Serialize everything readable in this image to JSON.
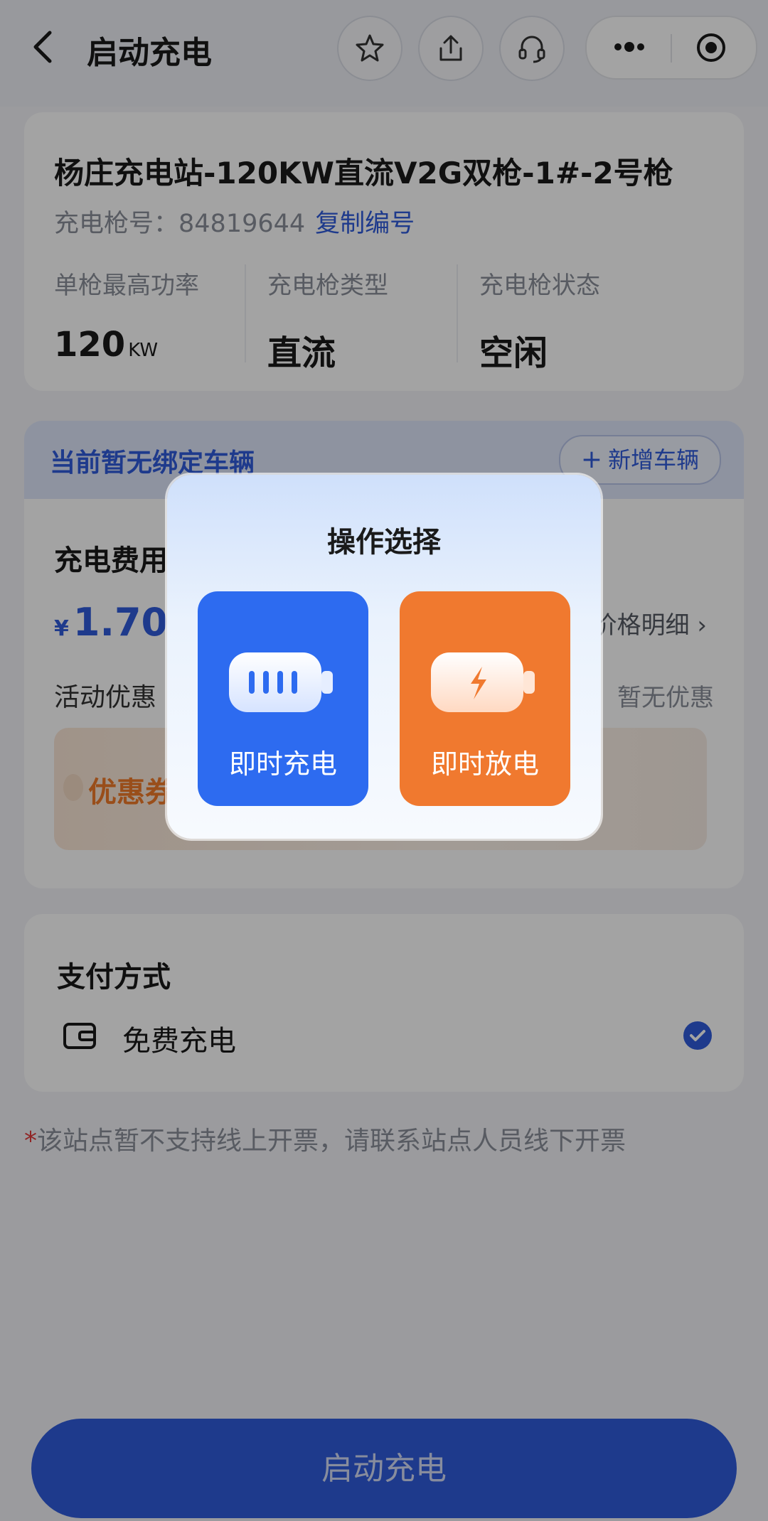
{
  "header": {
    "title": "启动充电",
    "icons": [
      "back-icon",
      "star-icon",
      "share-icon",
      "headset-icon",
      "more-icon",
      "target-icon"
    ]
  },
  "station": {
    "name": "杨庄充电站-120KW直流V2G双枪-1#-2号枪",
    "gun_label": "充电枪号：",
    "gun_number": "84819644",
    "copy_label": "复制编号",
    "specs": [
      {
        "label": "单枪最高功率",
        "value": "120",
        "unit": "KW"
      },
      {
        "label": "充电枪类型",
        "value": "直流",
        "unit": ""
      },
      {
        "label": "充电枪状态",
        "value": "空闲",
        "unit": ""
      }
    ]
  },
  "vehicle": {
    "status_text": "当前暂无绑定车辆",
    "add_label": "新增车辆"
  },
  "fee": {
    "title": "充电费用",
    "currency": "¥",
    "price": "1.70",
    "detail_label": "价格明细",
    "promo_label": "活动优惠",
    "promo_value": "暂无优惠",
    "coupon_label": "优惠券"
  },
  "payment": {
    "title": "支付方式",
    "option": "免费充电",
    "selected": true
  },
  "invoice_note": {
    "star": "*",
    "text": "该站点暂不支持线上开票，请联系站点人员线下开票"
  },
  "start_button": "启动充电",
  "modal": {
    "title": "操作选择",
    "options": [
      {
        "label": "即时充电",
        "color": "#2d6bf0",
        "icon": "battery-charge-icon"
      },
      {
        "label": "即时放电",
        "color": "#f0792f",
        "icon": "battery-discharge-icon"
      }
    ]
  },
  "colors": {
    "accent": "#2f5bdb",
    "coupon_orange": "#f07a2a",
    "required_red": "#e23b3b"
  }
}
